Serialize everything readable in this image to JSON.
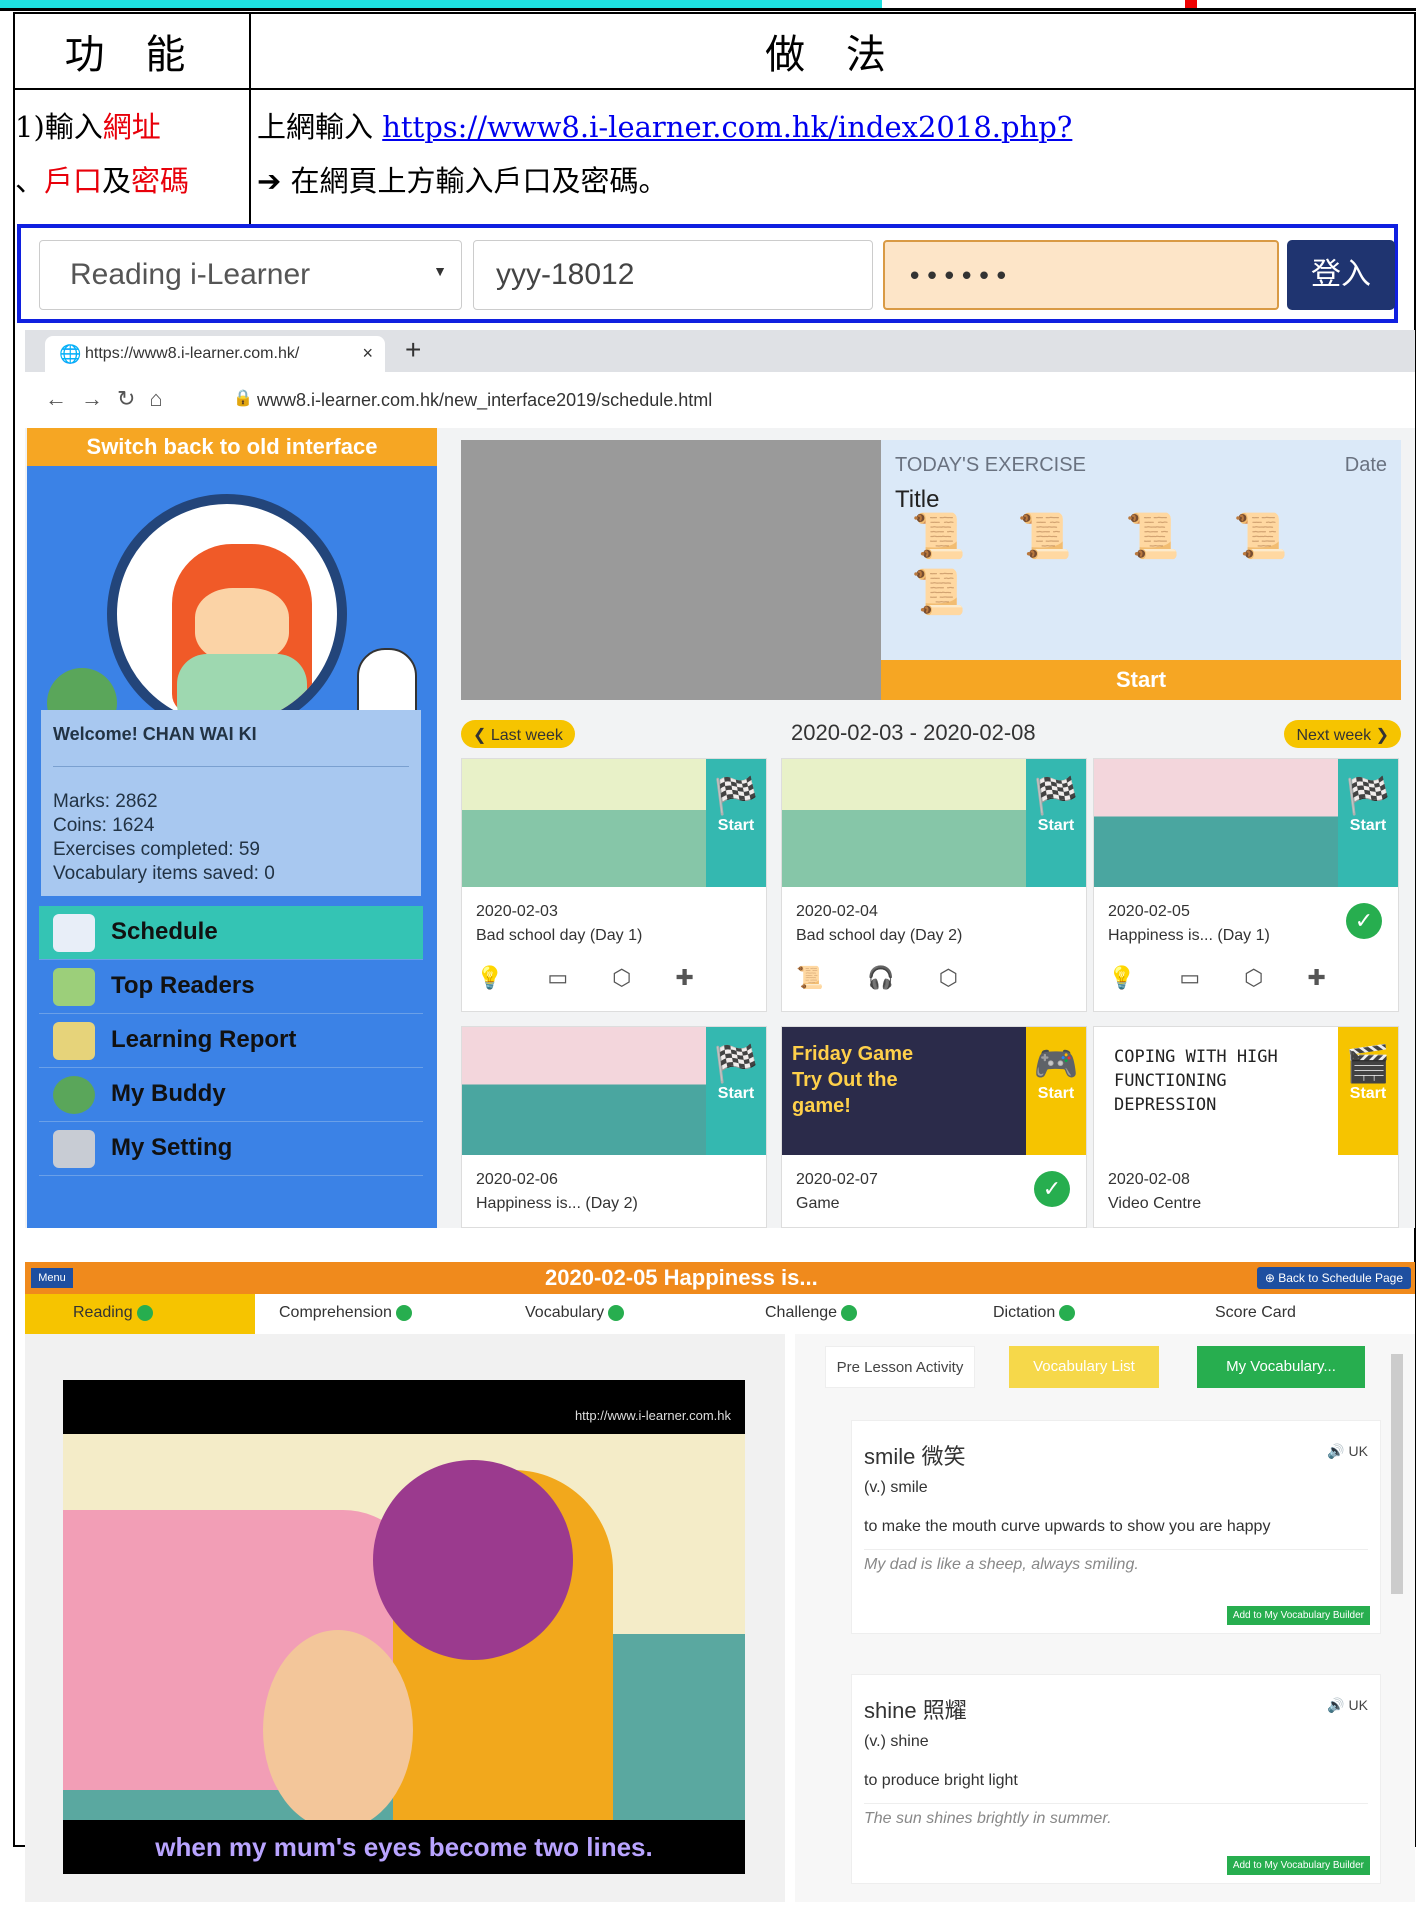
{
  "header": {
    "col1": "功 能",
    "col2": "做 法"
  },
  "step1": {
    "label_prefix": "1)輸入",
    "label_red1": "網址",
    "label_sep": "、",
    "label_red2": "戶口",
    "label_mid": "及",
    "label_red3": "密碼",
    "line1_text": "上網輸入 ",
    "line1_link": "https://www8.i-learner.com.hk/index2018.php?",
    "line2_arrow": "➔",
    "line2_text": " 在網頁上方輸入戶口及密碼。"
  },
  "login": {
    "select_value": "Reading i-Learner",
    "username": "yyy-18012",
    "password": "••••••",
    "button": "登入"
  },
  "browser": {
    "tab_title": "https://www8.i-learner.com.hk/",
    "url": "www8.i-learner.com.hk/new_interface2019/schedule.html",
    "nav_icons": [
      "back-icon",
      "forward-icon",
      "reload-icon",
      "home-icon"
    ]
  },
  "schedule": {
    "switch_old": "Switch back to old interface",
    "welcome": "Welcome! CHAN WAI KI",
    "stats": [
      "Marks: 2862",
      "Coins: 1624",
      "Exercises completed: 59",
      "Vocabulary items saved: 0"
    ],
    "menu": [
      "Schedule",
      "Top Readers",
      "Learning Report",
      "My Buddy",
      "My Setting"
    ],
    "today_header": "TODAY'S EXERCISE",
    "today_date": "Date",
    "today_title": "Title",
    "today_start": "Start",
    "last_week": "❮ Last week",
    "next_week": "Next week ❯",
    "range": "2020-02-03 - 2020-02-08",
    "cards": [
      {
        "date": "2020-02-03",
        "title": "Bad school day (Day 1)",
        "start": "Start"
      },
      {
        "date": "2020-02-04",
        "title": "Bad school day (Day 2)",
        "start": "Start"
      },
      {
        "date": "2020-02-05",
        "title": "Happiness is... (Day 1)",
        "start": "Start"
      },
      {
        "date": "2020-02-06",
        "title": "Happiness is... (Day 2)",
        "start": "Start"
      },
      {
        "date": "2020-02-07",
        "title": "Game",
        "start": "Start",
        "game_text": "Friday Game Try Out the game!"
      },
      {
        "date": "2020-02-08",
        "title": "Video Centre",
        "start": "Start",
        "vid_text": "COPING WITH HIGH FUNCTIONING DEPRESSION"
      }
    ]
  },
  "lesson": {
    "menu_btn": "Menu",
    "title": "2020-02-05     Happiness is...",
    "back_btn": "⊕ Back to Schedule Page",
    "tabs": [
      "Reading",
      "Comprehension",
      "Vocabulary",
      "Challenge",
      "Dictation",
      "Score Card"
    ],
    "video_url": "http://www.i-learner.com.hk",
    "subtitle": "when my mum's eyes become two lines.",
    "pre_lesson": "Pre Lesson Activity",
    "vocab_list": "Vocabulary List",
    "my_vocab": "My Vocabulary...",
    "uk": "UK",
    "add_btn": "Add to My Vocabulary Builder",
    "words": [
      {
        "word": "smile 微笑",
        "pos": "(v.) smile",
        "def": "to make the mouth curve upwards to show you are happy",
        "ex": "My dad is like a sheep, always smiling."
      },
      {
        "word": "shine 照耀",
        "pos": "(v.) shine",
        "def": "to produce bright light",
        "ex": "The sun shines brightly in summer."
      }
    ]
  }
}
